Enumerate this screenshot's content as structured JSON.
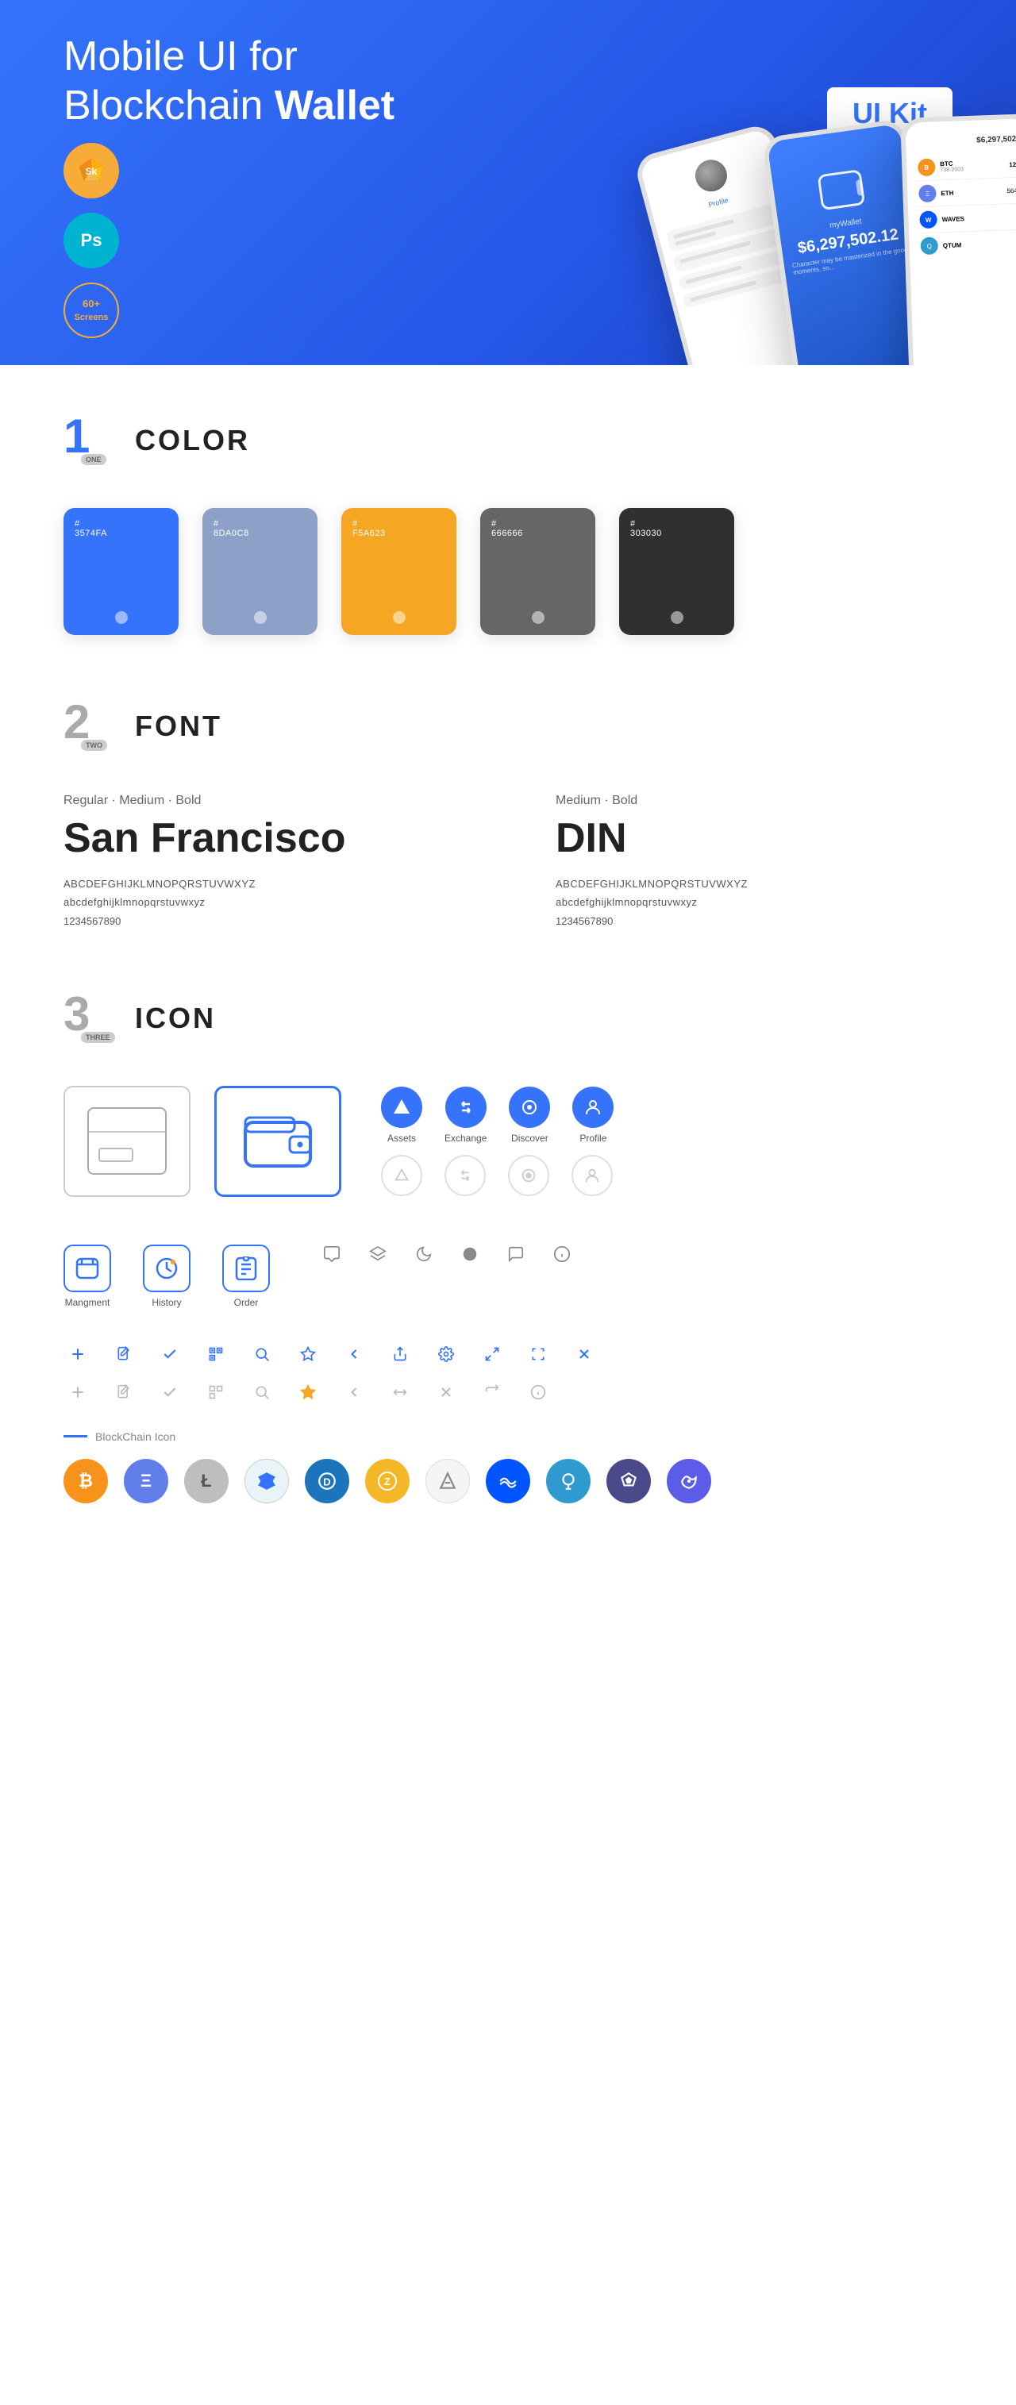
{
  "hero": {
    "title_start": "Mobile UI for Blockchain ",
    "title_bold": "Wallet",
    "badge": "UI Kit",
    "badge_sketch": "Sk",
    "badge_ps": "Ps",
    "badge_screens": "60+\nScreens"
  },
  "section1": {
    "number": "1",
    "label": "ONE",
    "title": "COLOR",
    "colors": [
      {
        "hex": "#3574FA",
        "code": "#\n3574FA",
        "dark_text": false
      },
      {
        "hex": "#8DA0C8",
        "code": "#\n8DA0C8",
        "dark_text": false
      },
      {
        "hex": "#F5A623",
        "code": "#\nF5A623",
        "dark_text": false
      },
      {
        "hex": "#666666",
        "code": "#\n666666",
        "dark_text": false
      },
      {
        "hex": "#303030",
        "code": "#\n303030",
        "dark_text": false
      }
    ]
  },
  "section2": {
    "number": "2",
    "label": "TWO",
    "title": "FONT",
    "font1": {
      "weights": "Regular · Medium · Bold",
      "name": "San Francisco",
      "upper": "ABCDEFGHIJKLMNOPQRSTUVWXYZ",
      "lower": "abcdefghijklmnopqrstuvwxyz",
      "numbers": "1234567890"
    },
    "font2": {
      "weights": "Medium · Bold",
      "name": "DIN",
      "upper": "ABCDEFGHIJKLMNOPQRSTUVWXYZ",
      "lower": "abcdefghijklmnopqrstuvwxyz",
      "numbers": "1234567890"
    }
  },
  "section3": {
    "number": "3",
    "label": "THREE",
    "title": "ICON",
    "nav_icons": [
      {
        "label": "Assets",
        "icon": "◆"
      },
      {
        "label": "Exchange",
        "icon": "⇌"
      },
      {
        "label": "Discover",
        "icon": "●"
      },
      {
        "label": "Profile",
        "icon": "⌒"
      }
    ],
    "mgmt_icons": [
      {
        "label": "Mangment",
        "icon": "▭"
      },
      {
        "label": "History",
        "icon": "◷"
      },
      {
        "label": "Order",
        "icon": "≡"
      }
    ]
  },
  "blockchain_label": "BlockChain Icon",
  "crypto": [
    {
      "symbol": "₿",
      "name": "Bitcoin",
      "class": "crypto-btc"
    },
    {
      "symbol": "Ξ",
      "name": "Ethereum",
      "class": "crypto-eth"
    },
    {
      "symbol": "Ł",
      "name": "Litecoin",
      "class": "crypto-ltc"
    },
    {
      "symbol": "✦",
      "name": "NEM",
      "class": "crypto-nem"
    },
    {
      "symbol": "D",
      "name": "Dash",
      "class": "crypto-dash"
    },
    {
      "symbol": "Z",
      "name": "Zcash",
      "class": "crypto-zcash"
    },
    {
      "symbol": "◈",
      "name": "IOTA",
      "class": "crypto-iota"
    },
    {
      "symbol": "W",
      "name": "Waves",
      "class": "crypto-waves"
    },
    {
      "symbol": "Q",
      "name": "Qtum",
      "class": "crypto-qtum"
    },
    {
      "symbol": "⬡",
      "name": "Band",
      "class": "crypto-band"
    },
    {
      "symbol": "P",
      "name": "Poly",
      "class": "crypto-poly"
    }
  ]
}
